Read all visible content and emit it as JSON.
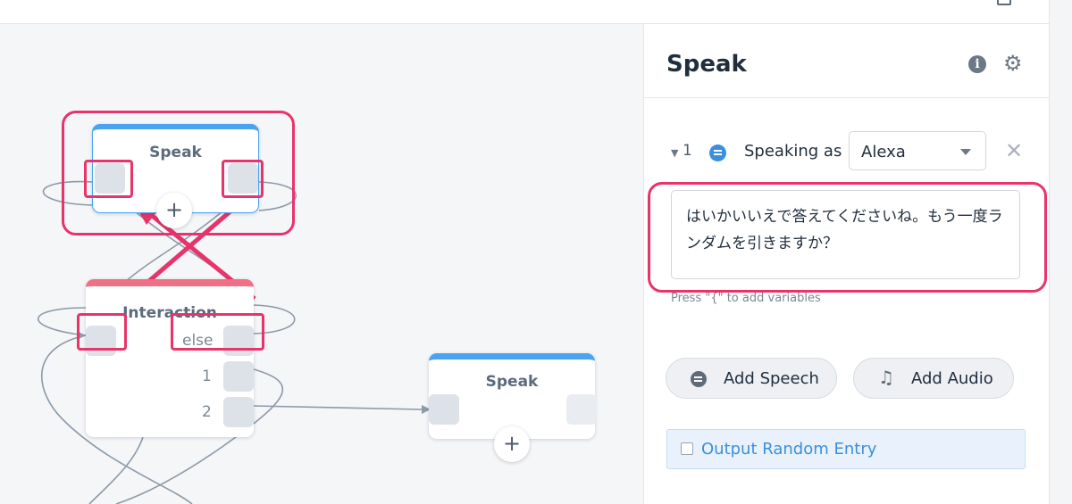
{
  "canvas": {
    "node_speak_top": {
      "title": "Speak",
      "add_label": "+"
    },
    "node_interaction": {
      "title": "Interaction",
      "ports": [
        "else",
        "1",
        "2"
      ]
    },
    "node_speak_right": {
      "title": "Speak",
      "add_label": "+"
    }
  },
  "panel": {
    "title": "Speak",
    "info_icon": "i",
    "gear_icon": "⚙",
    "entry": {
      "number": "1",
      "caret": "▼",
      "speaking_label": "Speaking as",
      "voice": "Alexa",
      "close_icon": "✕",
      "text": "はいかいいえで答えてくださいね。もう一度ランダムを引きますか？",
      "hint": "Press \"{\" to add variables"
    },
    "add_speech_label": "Add Speech",
    "add_audio_label": "Add Audio",
    "music_icon": "♫",
    "random_label": "Output Random Entry"
  },
  "colors": {
    "accent_blue": "#4aa3f0",
    "interaction_red": "#ef6f85",
    "highlight_pink": "#e8336b",
    "link_blue": "#3b8fe0"
  }
}
